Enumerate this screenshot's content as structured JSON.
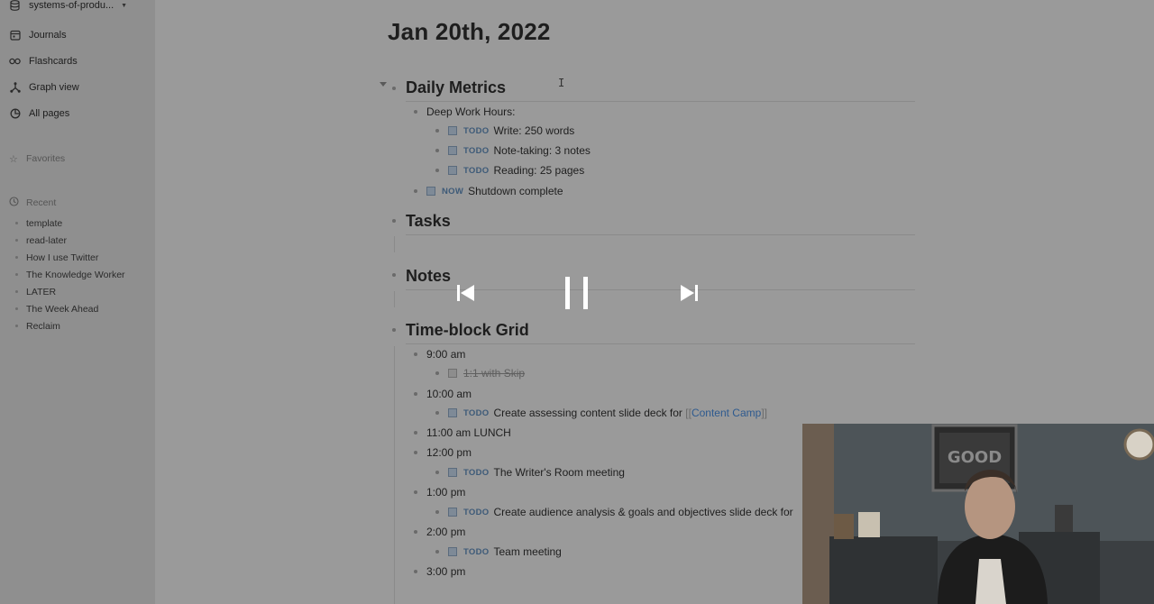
{
  "sidebar": {
    "graph_name": "systems-of-produ...",
    "nav": [
      {
        "label": "Journals",
        "icon": "calendar-icon"
      },
      {
        "label": "Flashcards",
        "icon": "infinity-icon"
      },
      {
        "label": "Graph view",
        "icon": "graph-icon"
      },
      {
        "label": "All pages",
        "icon": "pages-icon"
      }
    ],
    "favorites_label": "Favorites",
    "recent_label": "Recent",
    "recent_items": [
      "template",
      "read-later",
      "How I use Twitter",
      "The Knowledge Worker",
      "LATER",
      "The Week Ahead",
      "Reclaim"
    ]
  },
  "page": {
    "title": "Jan 20th, 2022",
    "sections": {
      "daily_metrics": "Daily Metrics",
      "tasks": "Tasks",
      "notes": "Notes",
      "timeblock": "Time-block Grid"
    },
    "deep_work": "Deep Work Hours:",
    "metrics": [
      {
        "marker": "TODO",
        "text": "Write: 250 words"
      },
      {
        "marker": "TODO",
        "text": "Note-taking: 3 notes"
      },
      {
        "marker": "TODO",
        "text": "Reading: 25 pages"
      }
    ],
    "shutdown": {
      "marker": "NOW",
      "text": "Shutdown complete"
    },
    "times": {
      "t900": "9:00 am",
      "t1000": "10:00 am",
      "t1100": "11:00 am LUNCH",
      "t1200": "12:00 pm",
      "t100": "1:00 pm",
      "t200": "2:00 pm",
      "t300": "3:00 pm"
    },
    "t900_task": "1:1 with Skip",
    "t1000_task": {
      "marker": "TODO",
      "text": "Create assessing content slide deck for ",
      "link": "Content Camp",
      "open": "[[",
      "close": "]]"
    },
    "t1200_task": {
      "marker": "TODO",
      "text": "The Writer's Room meeting"
    },
    "t100_task": {
      "marker": "TODO",
      "text": "Create audience analysis & goals and objectives slide deck for"
    },
    "t200_task": {
      "marker": "TODO",
      "text": "Team meeting"
    }
  },
  "media": {
    "prev": "previous",
    "pause": "pause",
    "next": "next"
  },
  "colors": {
    "overlay": "#9a9a9a",
    "todo_marker": "#3d5a78",
    "link": "#2e5a8f"
  }
}
